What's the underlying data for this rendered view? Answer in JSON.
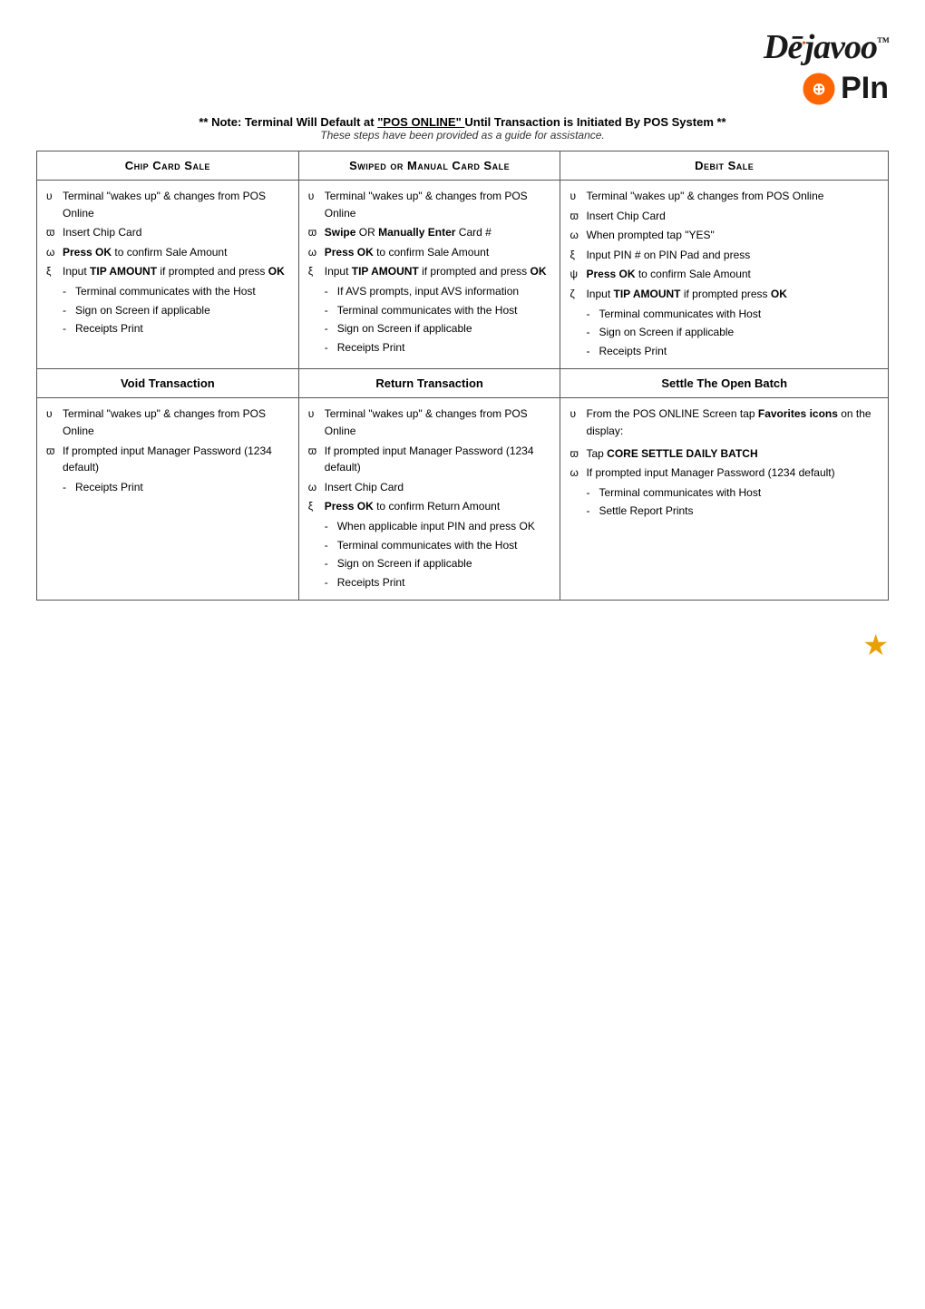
{
  "header": {
    "logo_dejavoo": "Dējavoo",
    "logo_pin": "PIn",
    "note": "** Note:  Terminal Will Default at",
    "note_underline": "\"POS ONLINE\"",
    "note_end": "Until Transaction is Initiated By POS System **",
    "guide": "These steps have been provided as a guide for assistance."
  },
  "table": {
    "row1": {
      "col1_header": "Chip Card Sale",
      "col2_header": "Swiped or Manual Card Sale",
      "col3_header": "Debit Sale",
      "col1_steps": [
        {
          "symbol": "υ",
          "text": "Terminal \"wakes up\" & changes from POS Online"
        },
        {
          "symbol": "ϖ",
          "text": "Insert Chip Card"
        },
        {
          "symbol": "ω",
          "bold_part": "Press OK",
          "text": " to confirm Sale Amount"
        },
        {
          "symbol": "ξ",
          "text": "Input ",
          "bold_part2": "TIP AMOUNT",
          "text2": " if prompted and press ",
          "bold_part3": "OK"
        },
        {
          "type": "sublist",
          "items": [
            "Terminal communicates with the Host",
            "Sign on Screen if applicable",
            "Receipts Print"
          ]
        }
      ],
      "col2_steps": [
        {
          "symbol": "υ",
          "text": "Terminal \"wakes up\" & changes from POS Online"
        },
        {
          "symbol": "ϖ",
          "bold": "Swipe",
          "text": " OR ",
          "bold2": "Manually Enter",
          "text2": " Card #"
        },
        {
          "symbol": "ω",
          "bold_part": "Press OK",
          "text": " to confirm Sale Amount"
        },
        {
          "symbol": "ξ",
          "text": "Input ",
          "bold_part2": "TIP AMOUNT",
          "text2": " if prompted and press ",
          "bold_part3": "OK"
        },
        {
          "type": "sublist",
          "items": [
            "If AVS prompts, input AVS information",
            "Terminal communicates with the Host",
            "Sign on Screen if applicable",
            "Receipts Print"
          ]
        }
      ],
      "col3_steps": [
        {
          "symbol": "υ",
          "text": "Terminal \"wakes up\" & changes from POS Online"
        },
        {
          "symbol": "ϖ",
          "text": "Insert Chip Card"
        },
        {
          "symbol": "ω",
          "text": "When prompted tap \"YES\""
        },
        {
          "symbol": "ξ",
          "text": "Input PIN # on PIN Pad and press"
        },
        {
          "symbol": "ψ",
          "bold_part": "Press OK",
          "text": " to confirm Sale Amount"
        },
        {
          "symbol": "ζ",
          "text": "Input ",
          "bold_part2": "TIP AMOUNT",
          "text2": " if prompted press ",
          "bold_part3": "OK"
        },
        {
          "type": "sublist",
          "items": [
            "Terminal communicates with Host",
            "Sign on Screen if applicable",
            "Receipts Print"
          ]
        }
      ]
    },
    "row2": {
      "col1_header": "Void Transaction",
      "col2_header": "Return Transaction",
      "col3_header": "Settle The Open Batch",
      "col1_steps": [
        {
          "symbol": "υ",
          "text": "Terminal \"wakes up\" & changes from POS Online"
        },
        {
          "symbol": "ϖ",
          "text": "If prompted input Manager Password (1234 default)"
        },
        {
          "type": "sublist",
          "items": [
            "Receipts Print"
          ]
        }
      ],
      "col2_steps": [
        {
          "symbol": "υ",
          "text": "Terminal \"wakes up\" & changes from POS Online"
        },
        {
          "symbol": "ϖ",
          "text": "If prompted input Manager Password (1234 default)"
        },
        {
          "symbol": "ω",
          "text": "Insert Chip Card"
        },
        {
          "symbol": "ξ",
          "bold_part": "Press OK",
          "text": " to confirm Return Amount"
        },
        {
          "type": "sublist",
          "items": [
            "When applicable input PIN and press OK",
            "Terminal communicates with the Host",
            "Sign on Screen if applicable",
            "Receipts Print"
          ]
        }
      ],
      "col3_steps": [
        {
          "symbol": "υ",
          "text": "From the POS ONLINE Screen tap ",
          "bold_part": "Favorites icons",
          "text2": " on the display:"
        },
        {
          "symbol": "ϖ",
          "text": "Tap ",
          "bold_part": "CORE SETTLE DAILY BATCH"
        },
        {
          "symbol": "ω",
          "text": "If prompted input Manager Password (1234 default)"
        },
        {
          "type": "sublist",
          "items": [
            "Terminal communicates with Host",
            "Settle Report Prints"
          ]
        }
      ]
    }
  },
  "footer": {
    "star": "★"
  }
}
